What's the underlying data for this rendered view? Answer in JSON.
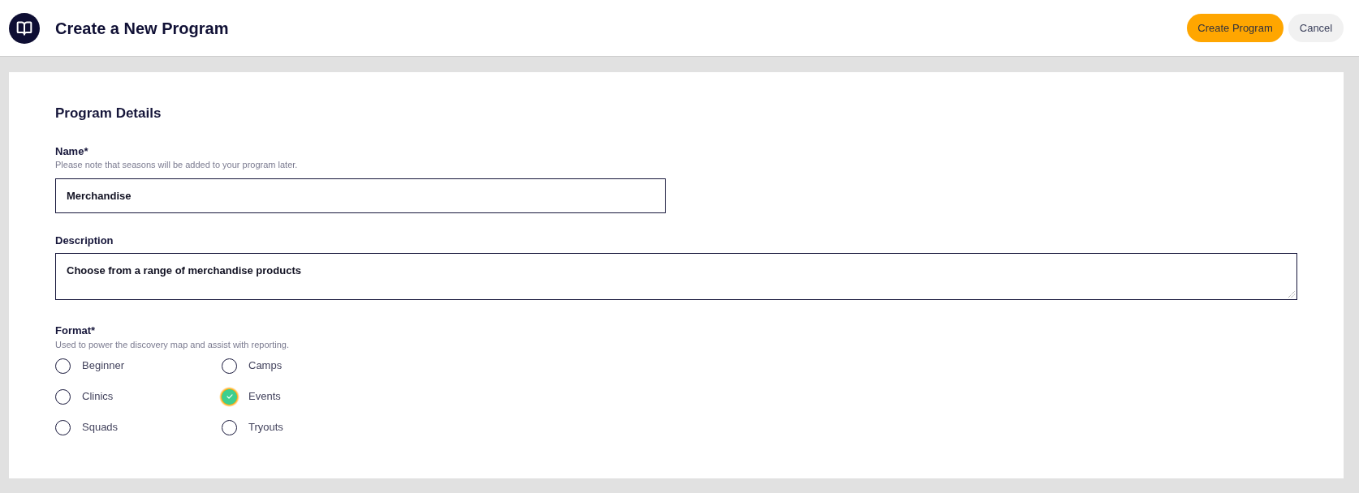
{
  "header": {
    "title": "Create a New Program",
    "buttons": [
      {
        "label": "Create Program",
        "kind": "primary"
      },
      {
        "label": "Cancel",
        "kind": "secondary"
      }
    ]
  },
  "form": {
    "title": "Program Details",
    "fields": [
      {
        "kind": "input",
        "label": "Name*",
        "hint": "Please note that seasons will be added to your program later.",
        "value": "Merchandise"
      },
      {
        "kind": "textarea",
        "label": "Description",
        "value": "Choose from a range of merchandise products"
      }
    ],
    "format": {
      "label": "Format*",
      "hint": "Used to power the discovery map and assist with reporting.",
      "options": [
        {
          "label": "Beginner",
          "selected": false
        },
        {
          "label": "Camps",
          "selected": false
        },
        {
          "label": "Clinics",
          "selected": false
        },
        {
          "label": "Events",
          "selected": true
        },
        {
          "label": "Squads",
          "selected": false
        },
        {
          "label": "Tryouts",
          "selected": false
        }
      ]
    }
  }
}
